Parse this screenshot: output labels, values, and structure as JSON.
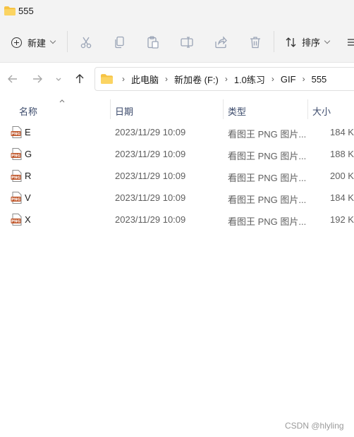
{
  "window": {
    "title": "555"
  },
  "toolbar": {
    "new_label": "新建",
    "sort_label": "排序",
    "icons": [
      "cut-icon",
      "copy-icon",
      "paste-icon",
      "rename-icon",
      "share-icon",
      "delete-icon",
      "more-icon"
    ]
  },
  "address_bar": {
    "crumbs": [
      "此电脑",
      "新加卷 (F:)",
      "1.0练习",
      "GIF",
      "555"
    ]
  },
  "columns": {
    "name": "名称",
    "date": "日期",
    "type": "类型",
    "size": "大小"
  },
  "files": [
    {
      "name": "E",
      "date": "2023/11/29 10:09",
      "type": "看图王 PNG 图片...",
      "size": "184 K"
    },
    {
      "name": "G",
      "date": "2023/11/29 10:09",
      "type": "看图王 PNG 图片...",
      "size": "188 K"
    },
    {
      "name": "R",
      "date": "2023/11/29 10:09",
      "type": "看图王 PNG 图片...",
      "size": "200 K"
    },
    {
      "name": "V",
      "date": "2023/11/29 10:09",
      "type": "看图王 PNG 图片...",
      "size": "184 K"
    },
    {
      "name": "X",
      "date": "2023/11/29 10:09",
      "type": "看图王 PNG 图片...",
      "size": "192 K"
    }
  ],
  "watermark": "CSDN @hlyling",
  "colors": {
    "folder": "#f6c344",
    "png_badge": "#c0562a"
  }
}
